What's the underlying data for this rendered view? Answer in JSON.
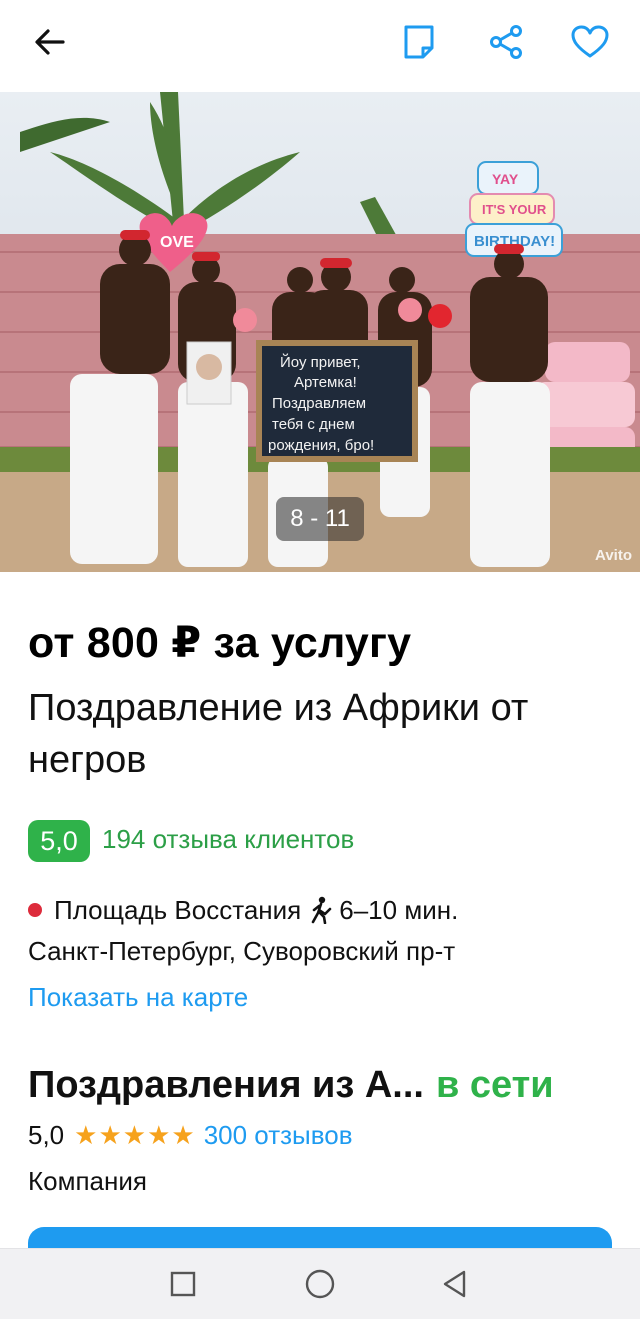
{
  "header": {
    "icons": [
      "back-arrow-icon",
      "note-icon",
      "share-icon",
      "heart-icon"
    ]
  },
  "gallery": {
    "counter": "8 - 11",
    "watermark": "Avito",
    "sign": {
      "line1": "Йоу привет,",
      "line2": "Артемка!",
      "line3": "Поздравляем",
      "line4": "тебя с днем",
      "line5": "рождения, бро!"
    },
    "heart_text": "OVE",
    "cake_text": {
      "line1": "YAY",
      "line2": "IT'S YOUR",
      "line3": "BIRTHDAY!"
    }
  },
  "listing": {
    "price": "от 800 ₽ за услугу",
    "title": "Поздравление из Африки от негров",
    "rating": "5,0",
    "reviews": "194 отзыва клиентов",
    "metro_station": "Площадь Восстания",
    "walk_time": "6–10 мин.",
    "address": "Санкт-Петербург, Суворовский пр-т",
    "map_link": "Показать на карте"
  },
  "seller": {
    "name": "Поздравления из А...",
    "status": "в сети",
    "rating": "5,0",
    "stars": "★★★★★",
    "reviews": "300 отзывов",
    "type": "Компания"
  },
  "colors": {
    "accent": "#1e9bf0",
    "green": "#2fb24a",
    "metro": "#dd2b3b",
    "star": "#f6a21d"
  },
  "system_nav": {
    "icons": [
      "recent-apps-icon",
      "home-icon",
      "back-icon"
    ]
  }
}
